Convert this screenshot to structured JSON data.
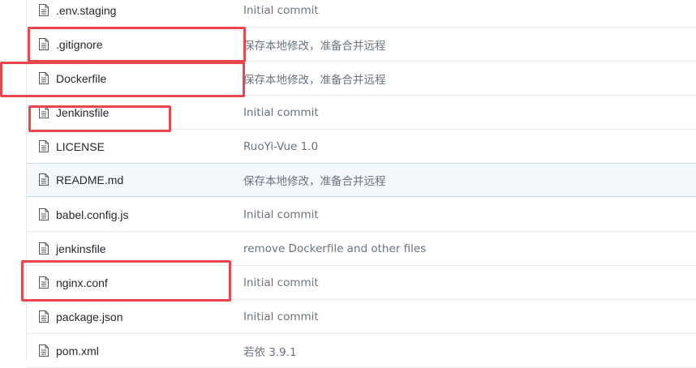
{
  "files": [
    {
      "name": ".env.staging",
      "commit": "Initial commit"
    },
    {
      "name": ".gitignore",
      "commit": "保存本地修改，准备合并远程"
    },
    {
      "name": "Dockerfile",
      "commit": "保存本地修改，准备合并远程"
    },
    {
      "name": "Jenkinsfile",
      "commit": "Initial commit"
    },
    {
      "name": "LICENSE",
      "commit": "RuoYi-Vue 1.0"
    },
    {
      "name": "README.md",
      "commit": "保存本地修改，准备合并远程"
    },
    {
      "name": "babel.config.js",
      "commit": "Initial commit"
    },
    {
      "name": "jenkinsfile",
      "commit": "remove Dockerfile and other files"
    },
    {
      "name": "nginx.conf",
      "commit": "Initial commit"
    },
    {
      "name": "package.json",
      "commit": "Initial commit"
    },
    {
      "name": "pom.xml",
      "commit": "若依 3.9.1"
    }
  ],
  "colors": {
    "highlight_row": "#f3f8fc",
    "annotation": "#e8474c",
    "commit_text": "#6a737d",
    "file_text": "#24292e"
  },
  "icons": {
    "file": "file-icon"
  }
}
